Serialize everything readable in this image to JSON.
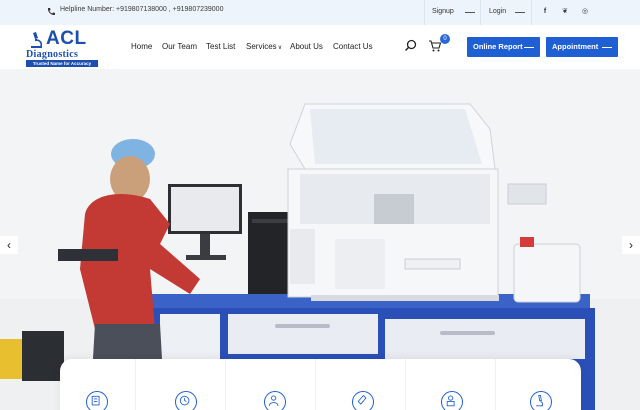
{
  "topbar": {
    "helpline": "Helpline Number: +919807138000 , +919807239000",
    "signup_label": "Signup",
    "login_label": "Login",
    "social_icons": [
      "facebook-icon",
      "twitter-icon",
      "instagram-icon"
    ],
    "social_glyphs": [
      "f",
      "❦",
      "◎"
    ]
  },
  "logo": {
    "brand": "ACL",
    "name": "Diagnostics",
    "tagline": "Trusted Name for Accuracy"
  },
  "nav": {
    "items": [
      "Home",
      "Our Team",
      "Test List",
      "Services",
      "About Us",
      "Contact Us"
    ],
    "services_chevron": "∨"
  },
  "cart": {
    "count": "0"
  },
  "buttons": {
    "online_report": "Online Report",
    "appointment": "Appointment"
  },
  "slider": {
    "prev_glyph": "‹",
    "next_glyph": "›"
  },
  "feature_icons": [
    "report-icon",
    "clock-icon",
    "doctor-icon",
    "test-tube-icon",
    "lab-technician-icon",
    "microscope-icon"
  ],
  "colors": {
    "brand_blue": "#1e5fd3",
    "logo_blue": "#1d4fae",
    "topbar_bg": "#eef4fb"
  }
}
